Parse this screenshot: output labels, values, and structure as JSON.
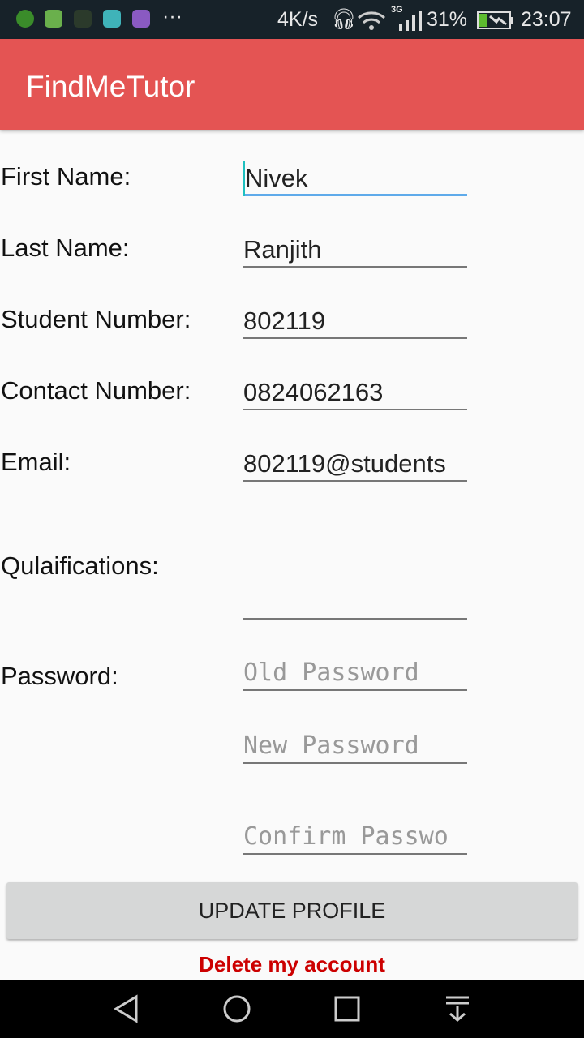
{
  "status_bar": {
    "speed": "4K/s",
    "network": "3G",
    "battery": "31%",
    "time": "23:07",
    "notification_icons": [
      "whatsapp-icon",
      "headset-app-icon",
      "blackberry-icon",
      "android-icon",
      "gallery-icon"
    ],
    "more": "···"
  },
  "app_bar": {
    "title": "FindMeTutor",
    "color": "#e45453"
  },
  "form": {
    "first_name": {
      "label": "First Name:",
      "value": "Nivek"
    },
    "last_name": {
      "label": "Last Name:",
      "value": "Ranjith"
    },
    "student_number": {
      "label": "Student Number:",
      "value": "802119"
    },
    "contact_number": {
      "label": "Contact Number:",
      "value": "0824062163"
    },
    "email": {
      "label": "Email:",
      "value": "802119@students"
    },
    "qualifications": {
      "label": "Qulaifications:",
      "value": ""
    },
    "password": {
      "label": "Password:",
      "old_placeholder": "Old Password",
      "new_placeholder": "New Password",
      "confirm_placeholder": "Confirm Passwo"
    }
  },
  "update_button": "UPDATE PROFILE",
  "delete_link": "Delete my account"
}
